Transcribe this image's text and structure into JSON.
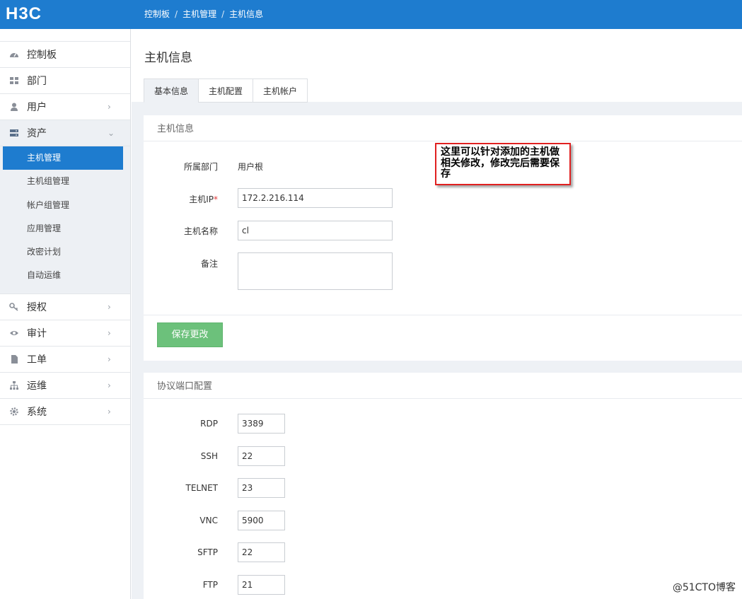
{
  "brand": {
    "logo_text": "H3C"
  },
  "breadcrumb": [
    "控制板",
    "主机管理",
    "主机信息"
  ],
  "sidebar": {
    "items": [
      {
        "label": "控制板",
        "icon": "dashboard-icon",
        "has_chevron": false
      },
      {
        "label": "部门",
        "icon": "grid-icon",
        "has_chevron": false
      },
      {
        "label": "用户",
        "icon": "user-icon",
        "has_chevron": true
      },
      {
        "label": "资产",
        "icon": "server-icon",
        "has_chevron": true,
        "expanded": true
      }
    ],
    "sub_items": [
      {
        "label": "主机管理",
        "active": true
      },
      {
        "label": "主机组管理"
      },
      {
        "label": "帐户组管理"
      },
      {
        "label": "应用管理"
      },
      {
        "label": "改密计划"
      },
      {
        "label": "自动运维"
      }
    ],
    "items_after": [
      {
        "label": "授权",
        "icon": "key-icon"
      },
      {
        "label": "审计",
        "icon": "eye-icon"
      },
      {
        "label": "工单",
        "icon": "document-icon"
      },
      {
        "label": "运维",
        "icon": "sitemap-icon"
      },
      {
        "label": "系统",
        "icon": "gear-icon"
      }
    ]
  },
  "main": {
    "title": "主机信息",
    "tabs": [
      {
        "label": "基本信息",
        "active": true
      },
      {
        "label": "主机配置"
      },
      {
        "label": "主机帐户"
      }
    ],
    "host_info": {
      "heading": "主机信息",
      "dept_label": "所属部门",
      "dept_value": "用户根",
      "ip_label": "主机IP",
      "ip_required": "*",
      "ip_value": "172.2.216.114",
      "name_label": "主机名称",
      "name_value": "cl",
      "note_label": "备注",
      "note_value": "",
      "save_button": "保存更改"
    },
    "ports": {
      "heading": "协议端口配置",
      "rows": [
        {
          "label": "RDP",
          "value": "3389"
        },
        {
          "label": "SSH",
          "value": "22"
        },
        {
          "label": "TELNET",
          "value": "23"
        },
        {
          "label": "VNC",
          "value": "5900"
        },
        {
          "label": "SFTP",
          "value": "22"
        },
        {
          "label": "FTP",
          "value": "21"
        }
      ]
    }
  },
  "callout": {
    "text": "这里可以针对添加的主机做相关修改，修改完后需要保存"
  },
  "watermark": "@51CTO博客",
  "colors": {
    "topbar": "#1e7ccf",
    "active_nav": "#1e7ccf",
    "save_button": "#6cc17b",
    "callout_border": "#e02020"
  }
}
